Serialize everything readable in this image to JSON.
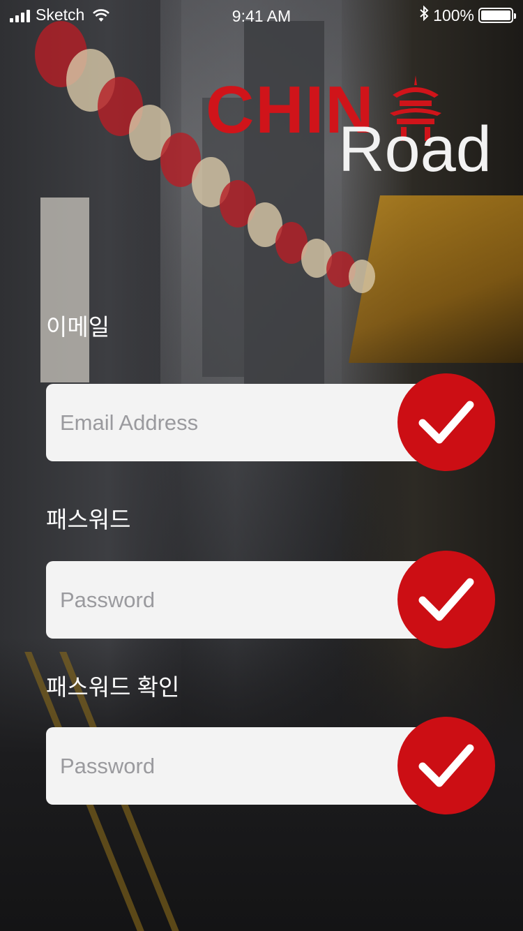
{
  "status_bar": {
    "carrier": "Sketch",
    "time": "9:41 AM",
    "battery": "100%"
  },
  "logo": {
    "brand_top": "CHIN",
    "brand_bottom": "Road"
  },
  "form": {
    "fields": [
      {
        "label": "이메일",
        "placeholder": "Email Address",
        "value": "",
        "check_icon": "checkmark-icon"
      },
      {
        "label": "패스워드",
        "placeholder": "Password",
        "value": "",
        "check_icon": "checkmark-icon"
      },
      {
        "label": "패스워드 확인",
        "placeholder": "Password",
        "value": "",
        "check_icon": "checkmark-icon"
      }
    ]
  },
  "colors": {
    "brand_red": "#cc0e14",
    "field_background": "#f3f3f3",
    "placeholder": "#9a9a9e"
  }
}
